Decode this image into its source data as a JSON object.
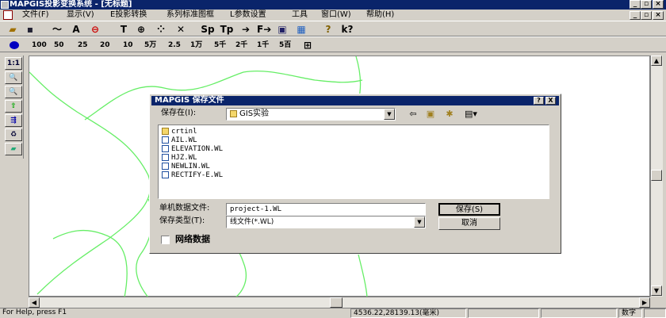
{
  "window": {
    "title": "MAPGIS投影变换系统 - [无标题]"
  },
  "menu": [
    "文件(F)",
    "显示(V)",
    "E投影转换",
    "系列标准图框",
    "L参数设置",
    "工具",
    "窗口(W)",
    "帮助(H)"
  ],
  "toolbar1": {
    "text_tool": "T",
    "sp_label": "Sp",
    "tp_label": "Tp",
    "help_label": "?",
    "context_help_label": "k?"
  },
  "scales": [
    "100",
    "50",
    "25",
    "20",
    "10",
    "5万",
    "2.5",
    "1万",
    "5千",
    "2千",
    "1千",
    "5百"
  ],
  "left_tools": [
    "1:1",
    "Q",
    "Q",
    "↑",
    "→",
    "",
    ""
  ],
  "dialog": {
    "title": "MAPGIS 保存文件",
    "help_btn": "?",
    "close_btn": "X",
    "save_in_label": "保存在(I):",
    "save_in_value": "GIS实验",
    "files": [
      {
        "name": "crtinl",
        "type": "folder"
      },
      {
        "name": "AIL.WL",
        "type": "file"
      },
      {
        "name": "ELEVATION.WL",
        "type": "file"
      },
      {
        "name": "HJZ.WL",
        "type": "file"
      },
      {
        "name": "NEWLIN.WL",
        "type": "file"
      },
      {
        "name": "RECTIFY-E.WL",
        "type": "file"
      }
    ],
    "filename_label": "单机数据文件:",
    "filename_value": "project-1.WL",
    "filetype_label": "保存类型(T):",
    "filetype_value": "线文件(*.WL)",
    "save_button": "保存(S)",
    "cancel_button": "取消",
    "network_label": "网络数据"
  },
  "status": {
    "help": "For Help, press F1",
    "coords": "4536.22,28139.13(毫米)",
    "mode": "数字"
  },
  "colors": {
    "title_bg": "#0a246a",
    "line_color": "#66ee66",
    "face": "#d4d0c8"
  }
}
